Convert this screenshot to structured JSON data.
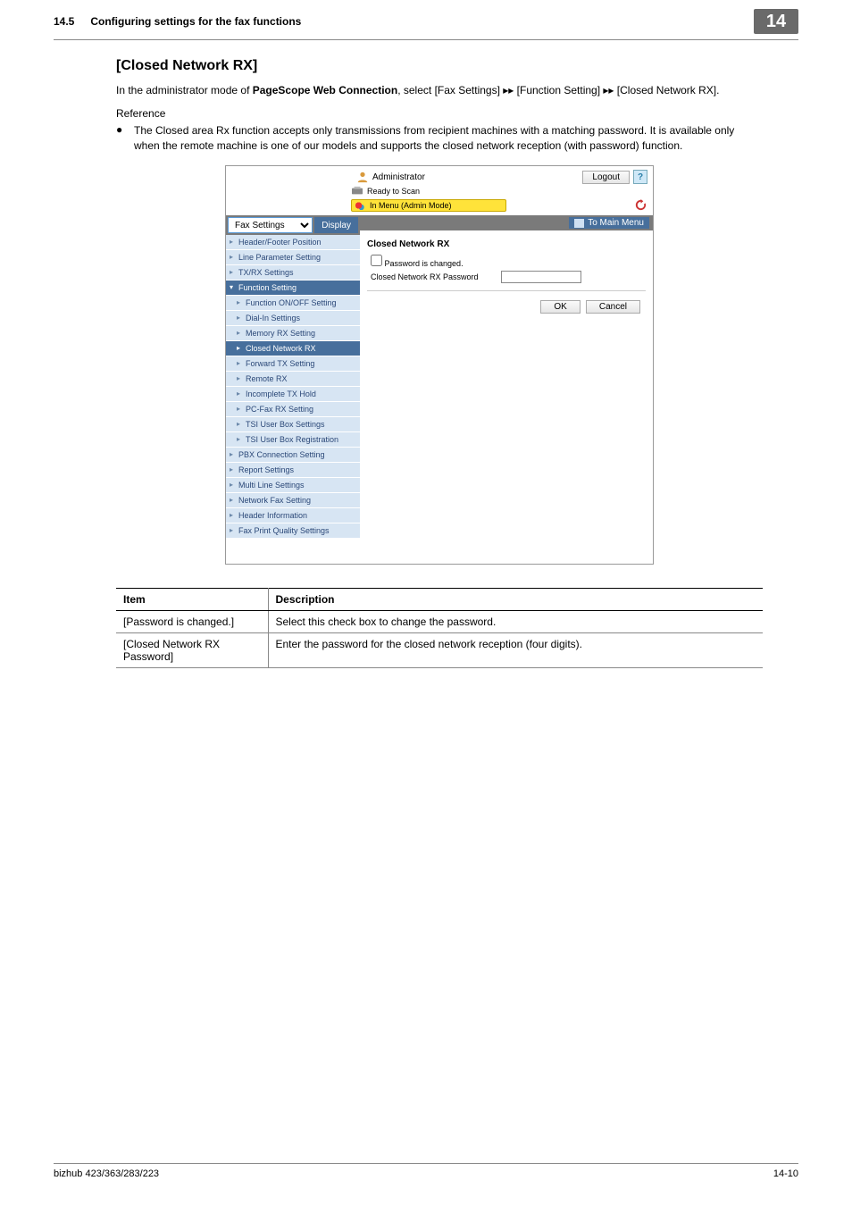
{
  "page": {
    "section_num": "14.5",
    "section_title": "Configuring settings for the fax functions",
    "chapter": "14",
    "footer_left": "bizhub 423/363/283/223",
    "footer_right": "14-10"
  },
  "doc": {
    "heading": "[Closed Network RX]",
    "intro_pre": "In the administrator mode of ",
    "intro_bold": "PageScope Web Connection",
    "intro_mid1": ", select [Fax Settings] ",
    "intro_mid2": " [Function Setting] ",
    "intro_post": " [Closed Network RX].",
    "arrow": "▸▸",
    "reference_label": "Reference",
    "bullet": "The Closed area Rx function accepts only transmissions from recipient machines with a matching password. It is available only when the remote machine is one of our models and supports the closed network reception (with password) function."
  },
  "app": {
    "admin_label": "Administrator",
    "logout": "Logout",
    "ready": "Ready to Scan",
    "admin_menu": "In Menu (Admin Mode)",
    "to_main": "To Main Menu",
    "select_value": "Fax Settings",
    "display_btn": "Display",
    "sidebar": {
      "items_top": [
        "Header/Footer Position",
        "Line Parameter Setting",
        "TX/RX Settings"
      ],
      "parent": "Function Setting",
      "subs": [
        "Function ON/OFF Setting",
        "Dial-In Settings",
        "Memory RX Setting",
        "Closed Network RX",
        "Forward TX Setting",
        "Remote RX",
        "Incomplete TX Hold",
        "PC-Fax RX Setting",
        "TSI User Box Settings",
        "TSI User Box Registration"
      ],
      "items_bottom": [
        "PBX Connection Setting",
        "Report Settings",
        "Multi Line Settings",
        "Network Fax Setting",
        "Header Information",
        "Fax Print Quality Settings"
      ]
    },
    "panel": {
      "title": "Closed Network RX",
      "check_label": "Password is changed.",
      "pw_label": "Closed Network RX Password",
      "ok": "OK",
      "cancel": "Cancel"
    }
  },
  "table": {
    "h1": "Item",
    "h2": "Description",
    "rows": [
      {
        "item": "[Password is changed.]",
        "desc": "Select this check box to change the password."
      },
      {
        "item": "[Closed Network RX Password]",
        "desc": "Enter the password for the closed network reception (four digits)."
      }
    ]
  }
}
